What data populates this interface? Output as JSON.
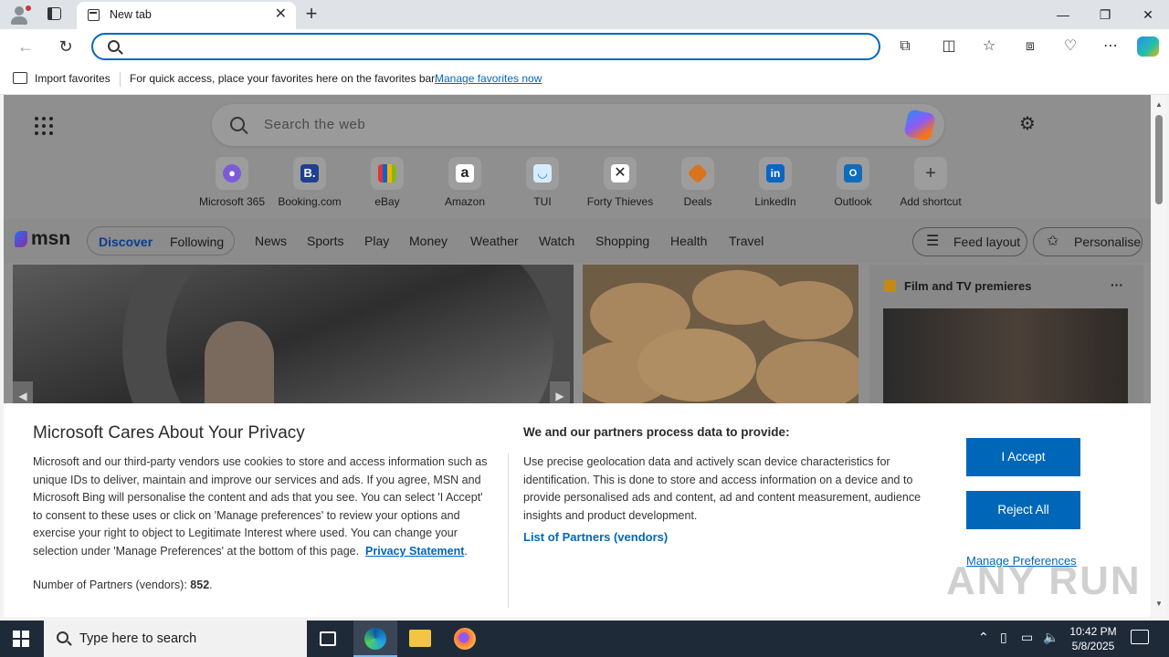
{
  "browser": {
    "tab_title": "New tab",
    "favorites_bar": {
      "import_label": "Import favorites",
      "hint": "For quick access, place your favorites here on the favorites bar.",
      "manage_link": "Manage favorites now"
    }
  },
  "newtab": {
    "search_placeholder": "Search the web",
    "shortcuts": [
      {
        "label": "Microsoft 365",
        "icon": "microsoft-365-icon",
        "color": "#7b5cd6"
      },
      {
        "label": "Booking.com",
        "icon": "booking-icon",
        "color": "#1f3f8f"
      },
      {
        "label": "eBay",
        "icon": "ebay-icon",
        "color": "#e53238"
      },
      {
        "label": "Amazon",
        "icon": "amazon-icon",
        "color": "#222222"
      },
      {
        "label": "TUI",
        "icon": "tui-icon",
        "color": "#1e73d8"
      },
      {
        "label": "Forty Thieves",
        "icon": "forty-thieves-icon",
        "color": "#222222"
      },
      {
        "label": "Deals",
        "icon": "deals-icon",
        "color": "#d9731e"
      },
      {
        "label": "LinkedIn",
        "icon": "linkedin-icon",
        "color": "#0a66c2"
      },
      {
        "label": "Outlook",
        "icon": "outlook-icon",
        "color": "#0f6cbd"
      },
      {
        "label": "Add shortcut",
        "icon": "plus-icon",
        "color": "#444444"
      }
    ],
    "feed_tabs": [
      "Discover",
      "Following"
    ],
    "nav": [
      "News",
      "Sports",
      "Play",
      "Money",
      "Weather",
      "Watch",
      "Shopping",
      "Health",
      "Travel"
    ],
    "feed_layout_label": "Feed layout",
    "personalise_label": "Personalise",
    "film_card_title": "Film and TV premieres"
  },
  "privacy": {
    "heading": "Microsoft Cares About Your Privacy",
    "body": "Microsoft and our third-party vendors use cookies to store and access information such as unique IDs to deliver, maintain and improve our services and ads. If you agree, MSN and Microsoft Bing will personalise the content and ads that you see. You can select 'I Accept' to consent to these uses or click on 'Manage preferences' to review your options and exercise your right to object to Legitimate Interest where used.  You can change your selection under 'Manage Preferences' at the bottom of this page.",
    "privacy_link": "Privacy Statement",
    "partners_label": "Number of Partners (vendors):",
    "partners_count": "852",
    "process_heading": "We and our partners process data to provide:",
    "process_body": "Use precise geolocation data and actively scan device characteristics for identification. This is done to store and access information on a device and to provide personalised ads and content, ad and content measurement, audience insights and product development.",
    "vendors_link": "List of Partners (vendors)",
    "accept_label": "I Accept",
    "reject_label": "Reject All",
    "manage_label": "Manage Preferences"
  },
  "watermark": "ANY RUN",
  "taskbar": {
    "search_placeholder": "Type here to search",
    "time": "10:42 PM",
    "date": "5/8/2025"
  }
}
